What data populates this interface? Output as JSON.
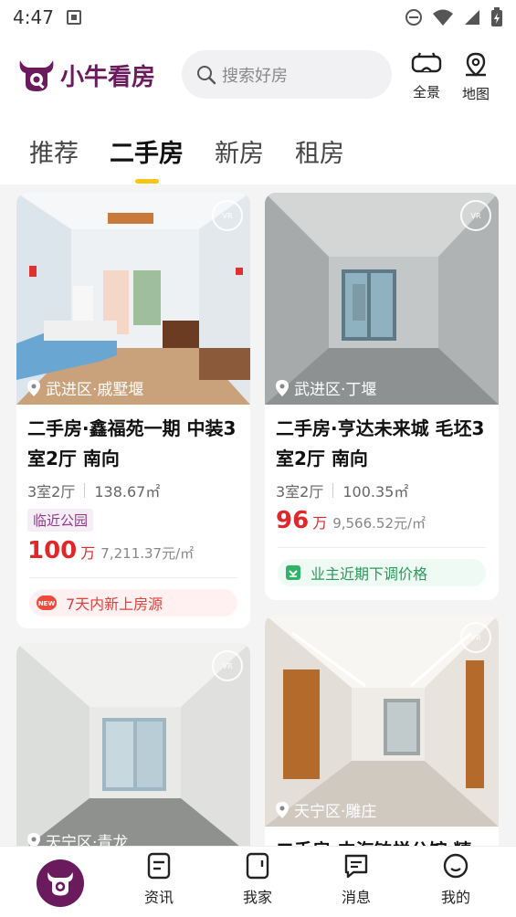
{
  "status": {
    "time": "4:47"
  },
  "header": {
    "logo_text": "小牛看房",
    "search_placeholder": "搜索好房",
    "panorama_label": "全景",
    "map_label": "地图"
  },
  "tabs": [
    {
      "label": "推荐",
      "active": false
    },
    {
      "label": "二手房",
      "active": true
    },
    {
      "label": "新房",
      "active": false
    },
    {
      "label": "租房",
      "active": false
    }
  ],
  "listings": [
    {
      "location": "武进区·戚墅堰",
      "title": "二手房·鑫福苑一期 中装3室2厅 南向",
      "layout": "3室2厅",
      "area": "138.67㎡",
      "tag": "临近公园",
      "price": "100",
      "price_unit": "万",
      "unit_price": "7,211.37元/㎡",
      "badge": "7天内新上房源",
      "badge_icon": "NEW"
    },
    {
      "location": "武进区·丁堰",
      "title": "二手房·亨达未来城 毛坯3室2厅 南向",
      "layout": "3室2厅",
      "area": "100.35㎡",
      "price": "96",
      "price_unit": "万",
      "unit_price": "9,566.52元/㎡",
      "badge": "业主近期下调价格"
    },
    {
      "location": "天宁区·青龙"
    },
    {
      "location": "天宁区·雕庄",
      "title": "二手房·中海铂悦公馆 精"
    }
  ],
  "bottom_nav": [
    {
      "label": "资讯"
    },
    {
      "label": "我家"
    },
    {
      "label": "消息"
    },
    {
      "label": "我的"
    }
  ],
  "colors": {
    "brand": "#6b1a5e",
    "price": "#e0282b",
    "tab_indicator": "#f5c518"
  }
}
